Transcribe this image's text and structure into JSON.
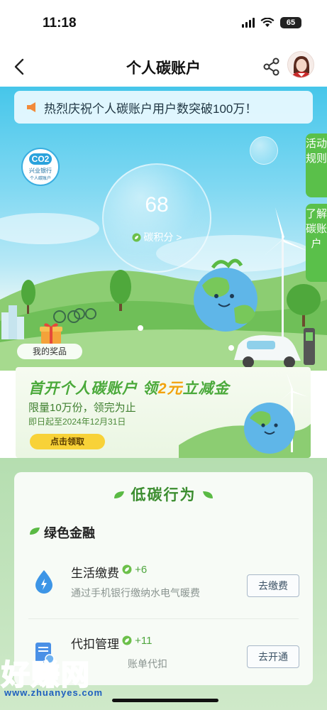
{
  "status_bar": {
    "time": "11:18",
    "battery": "65"
  },
  "nav": {
    "title": "个人碳账户"
  },
  "hero": {
    "notice": "热烈庆祝个人碳账户用户数突破100万！",
    "badge": {
      "co2": "CO2",
      "bank": "兴业银行",
      "sub": "个人碳账户"
    },
    "score": "68",
    "score_link": "碳积分 >",
    "side_tabs": {
      "rules": "活动规则",
      "about": "了解碳账户"
    },
    "prizes_label": "我的奖品"
  },
  "promo": {
    "title_a": "首开个人碳账户  领",
    "title_accent": "2元",
    "title_b": "立减金",
    "subtitle": "限量10万份，领完为止",
    "date": "即日起至2024年12月31日",
    "button": "点击领取"
  },
  "low_carbon": {
    "title": "低碳行为",
    "section": "绿色金融",
    "items": [
      {
        "name": "生活缴费",
        "points": "+6",
        "desc": "通过手机银行缴纳水电气暖费",
        "button": "去缴费"
      },
      {
        "name": "代扣管理",
        "points": "+11",
        "desc": "账单代扣",
        "button": "去开通"
      }
    ]
  },
  "watermark": {
    "text": "好赚网",
    "url": "www.zhuanyes.com"
  },
  "colors": {
    "primary_green": "#4aa93a",
    "sky": "#46c6ea",
    "accent_orange": "#f2a20c"
  }
}
